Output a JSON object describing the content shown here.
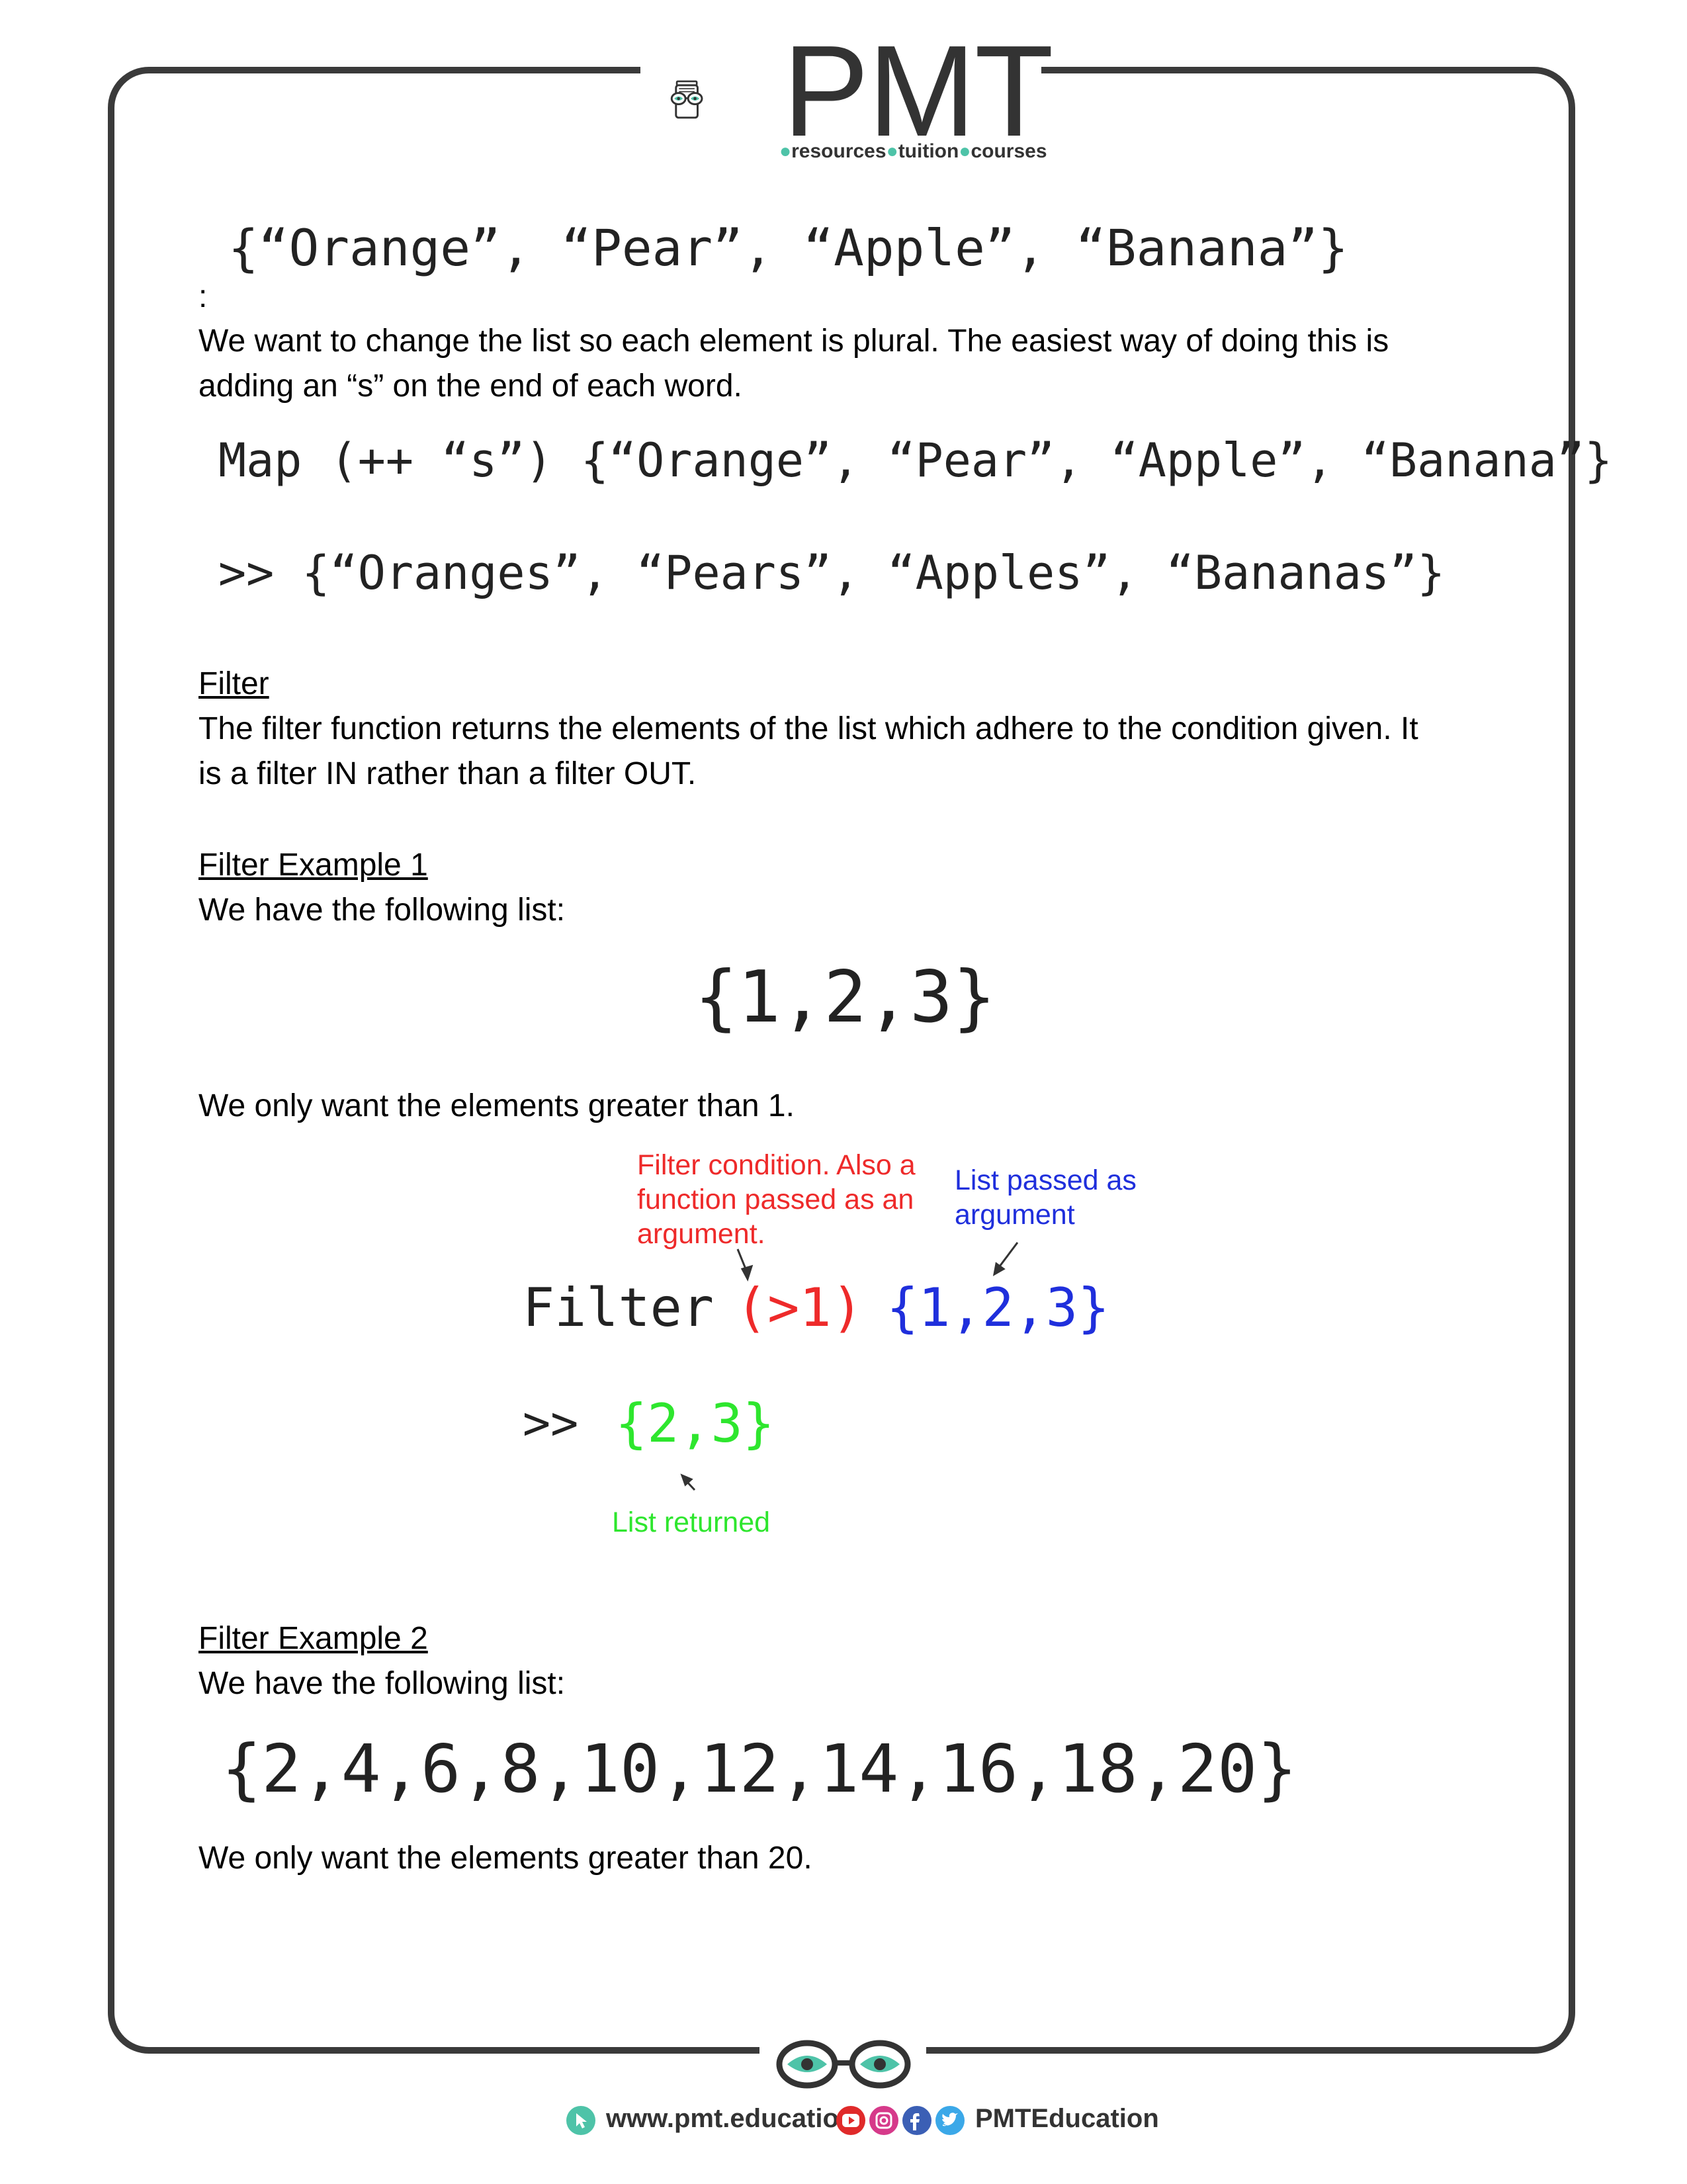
{
  "brand": {
    "name": "PMT",
    "tagline_words": [
      "resources",
      "tuition",
      "courses"
    ]
  },
  "content": {
    "code_list_fruits": "{“Orange”, “Pear”, “Apple”, “Banana”}",
    "colon": ":",
    "para_plural_1": "We want to change the list so each element is plural. The easiest way of doing this is",
    "para_plural_2": "adding an “s” on the end of each word.",
    "code_map": "Map (++ “s”) {“Orange”, “Pear”, “Apple”, “Banana”}",
    "code_map_result": ">> {“Oranges”, “Pears”, “Apples”, “Bananas”}",
    "filter_heading": "Filter",
    "filter_para_1": "The filter function returns the elements of the list which adhere to the condition given. It",
    "filter_para_2": "is a filter IN rather than a filter OUT.",
    "example1_heading": "Filter Example 1",
    "example1_intro": "We have the following list:",
    "example1_list": "{1,2,3}",
    "example1_goal": "We only want the elements greater than 1.",
    "diagram": {
      "ann_condition_1": "Filter condition. Also a",
      "ann_condition_2": "function passed as an",
      "ann_condition_3": "argument.",
      "ann_list_1": "List passed as",
      "ann_list_2": "argument",
      "code_keyword": "Filter",
      "code_condition": "(>1)",
      "code_list": "{1,2,3}",
      "code_result_prompt": ">>",
      "code_result": "{2,3}",
      "ann_returned": "List returned"
    },
    "example2_heading": "Filter Example 2",
    "example2_intro": "We have the following list:",
    "example2_list": "{2,4,6,8,10,12,14,16,18,20}",
    "example2_goal": "We only want the elements greater than 20."
  },
  "footer": {
    "website": "www.pmt.education",
    "social_handle": "PMTEducation",
    "social_icons": [
      "youtube-icon",
      "instagram-icon",
      "facebook-icon",
      "twitter-icon"
    ]
  },
  "colors": {
    "frame": "#3a3a3a",
    "accent_teal": "#4ec3a8",
    "annotation_red": "#ee2a2a",
    "annotation_blue": "#1f2fdc",
    "annotation_green": "#2ee62e"
  }
}
